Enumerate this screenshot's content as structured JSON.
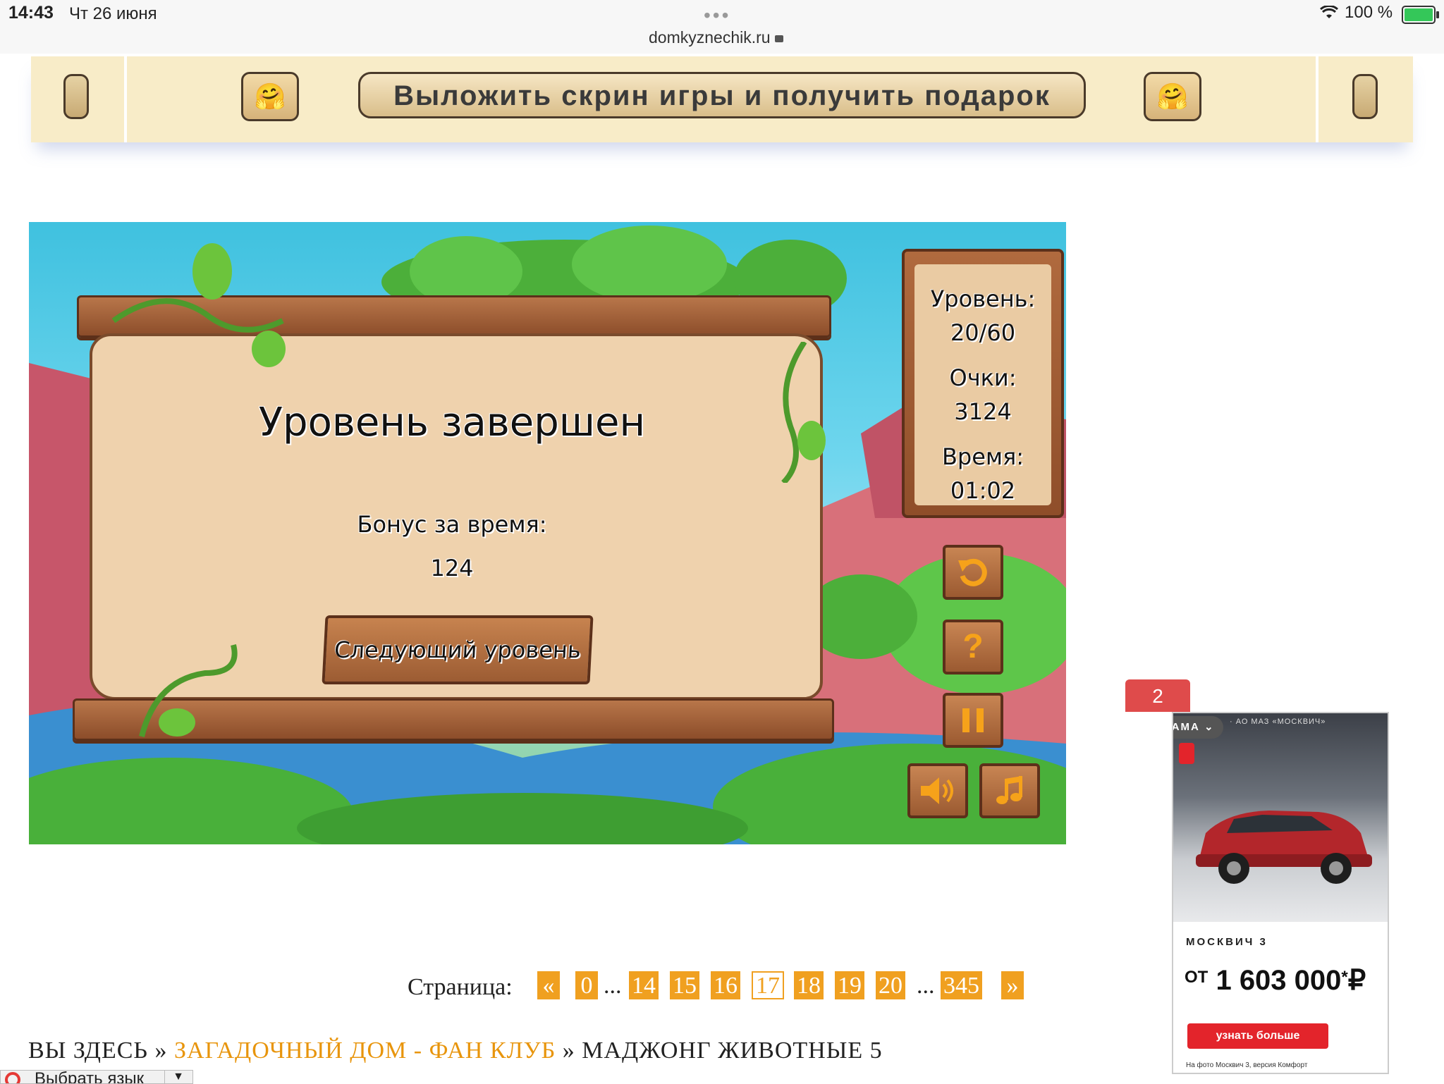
{
  "status_bar": {
    "time": "14:43",
    "date": "Чт 26 июня",
    "url": "domkyznechik.ru",
    "battery": "100 %"
  },
  "promo": {
    "label": "Выложить скрин игры и получить подарок",
    "emoji": "🤗"
  },
  "game": {
    "title": "Уровень завершен",
    "bonus_label": "Бонус за время:",
    "bonus_value": "124",
    "next_button": "Следующий уровень",
    "stats": {
      "level_label": "Уровень:",
      "level_value": "20/60",
      "score_label": "Очки:",
      "score_value": "3124",
      "time_label": "Время:",
      "time_value": "01:02"
    },
    "buttons": {
      "help": "?"
    }
  },
  "pagination": {
    "label": "Страница:",
    "prev": "«",
    "next": "»",
    "ellipsis": "...",
    "pages": [
      "0",
      "14",
      "15",
      "16",
      "17",
      "18",
      "19",
      "20",
      "345"
    ],
    "current": "17"
  },
  "breadcrumb": {
    "prefix": "ВЫ ЗДЕСЬ",
    "sep": "»",
    "link": "ЗАГАДОЧНЫЙ ДОМ - ФАН КЛУБ",
    "current": "МАДЖОНГ ЖИВОТНЫЕ 5"
  },
  "language": {
    "label": "Выбрать язык"
  },
  "ad": {
    "count": "2",
    "tag": "РЕКЛАМА",
    "topline": "· АО МАЗ «МОСКВИЧ»",
    "model": "МОСКВИЧ 3",
    "price_prefix": "ОТ",
    "price": "1 603 000",
    "currency": "₽",
    "cta": "узнать больше",
    "footnote": "На фото Москвич 3, версия Комфорт"
  },
  "colors": {
    "accent_orange": "#f0a020",
    "ad_red": "#e3242b",
    "wood": "#9c5c33",
    "parchment": "#efd2ad"
  }
}
